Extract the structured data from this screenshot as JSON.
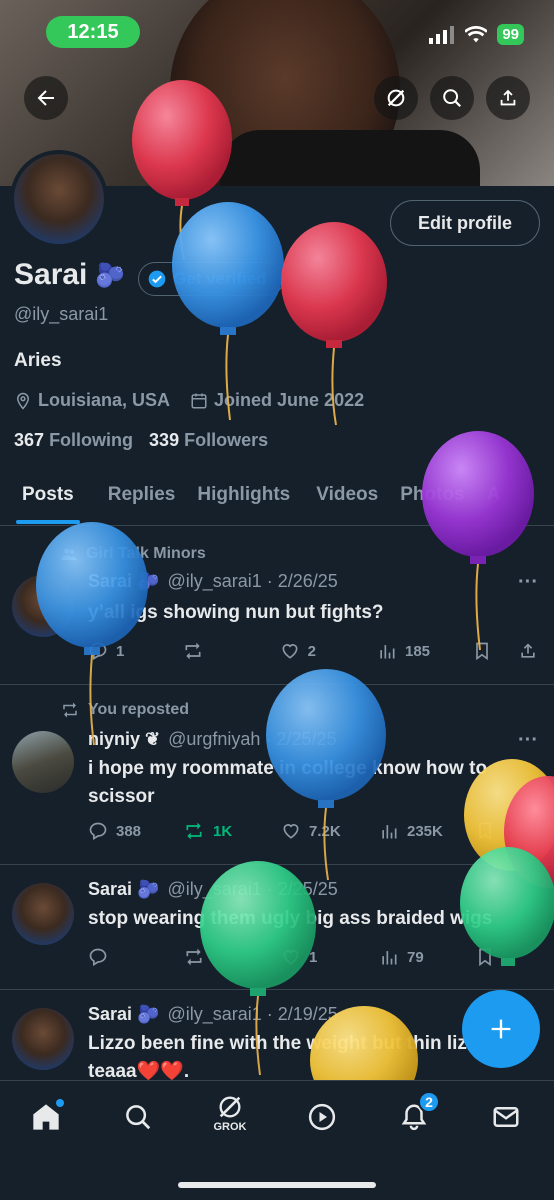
{
  "status": {
    "time": "12:15",
    "battery": "99"
  },
  "header": {
    "back_icon": "arrow-left-icon",
    "grok_icon": "grok-icon",
    "search_icon": "search-icon",
    "share_icon": "share-icon"
  },
  "profile": {
    "edit_label": "Edit profile",
    "name": "Sarai",
    "name_emoji": "🫐",
    "verify_label": "Get verified",
    "handle": "@ily_sarai1",
    "bio": "Aries",
    "location": "Louisiana, USA",
    "joined": "Joined June 2022",
    "following_count": "367",
    "following_label": "Following",
    "followers_count": "339",
    "followers_label": "Followers"
  },
  "tabs": [
    "Posts",
    "Replies",
    "Highlights",
    "Videos",
    "Photos",
    "A"
  ],
  "posts": [
    {
      "context": "Girl Talk Minors",
      "name": "Sarai 🫐",
      "handle": "@ily_sarai1 · 2/26/25",
      "text": "y’all igs showing nun but fights?",
      "comments": "1",
      "reposts": "",
      "likes": "2",
      "views": "185"
    },
    {
      "context": "You reposted",
      "name": "niyniy ❦",
      "handle": "@urgfniyah · 2/25/25",
      "text": "i hope my roommate in college know how to scissor",
      "comments": "388",
      "reposts": "1K",
      "likes": "7.2K",
      "views": "235K"
    },
    {
      "context": "",
      "name": "Sarai 🫐",
      "handle": "@ily_sarai1 · 2/25/25",
      "text": "stop wearing them ugly big ass braided wigs",
      "comments": "",
      "reposts": "",
      "likes": "1",
      "views": "79"
    },
    {
      "context": "",
      "name": "Sarai 🫐",
      "handle": "@ily_sarai1 · 2/19/25",
      "text": "Lizzo been fine with the weight but thin lizzo is teaaa❤️❤️.",
      "comments": "",
      "reposts": "",
      "likes": "",
      "views": ""
    }
  ],
  "nav": {
    "grok_label": "GROK",
    "notifications_badge": "2"
  },
  "colors": {
    "accent": "#1d9bf0",
    "background": "#15202b",
    "repost_active": "#00ba7c",
    "status_green": "#34c759"
  }
}
